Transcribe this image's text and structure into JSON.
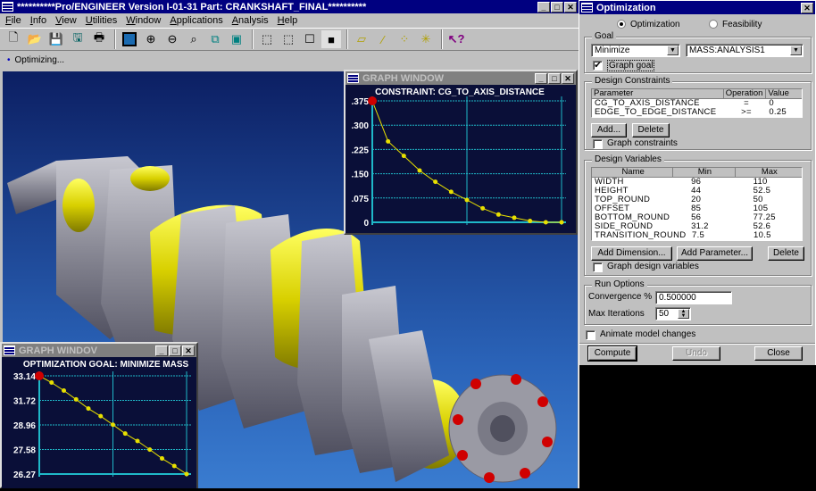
{
  "main_window": {
    "title": "**********Pro/ENGINEER Version I-01-31 Part: CRANKSHAFT_FINAL**********",
    "menu": [
      "File",
      "Info",
      "View",
      "Utilities",
      "Window",
      "Applications",
      "Analysis",
      "Help"
    ],
    "toolbar_icons": [
      "new-file-icon",
      "open-folder-icon",
      "save-icon",
      "save-copy-icon",
      "print-icon",
      "repaint-icon",
      "zoom-in-icon",
      "zoom-out-icon",
      "refit-icon",
      "orient-icon",
      "saved-views-icon",
      "wireframe-icon",
      "hidden-line-icon",
      "no-hidden-icon",
      "shading-icon",
      "datum-planes-icon",
      "datum-axes-icon",
      "datum-points-icon",
      "coordinate-systems-icon",
      "context-help-icon"
    ],
    "message": "Optimizing..."
  },
  "constraint_graph": {
    "window_title": "GRAPH WINDOW",
    "chart_data": {
      "type": "line",
      "title": "CONSTRAINT: CG_TO_AXIS_DISTANCE",
      "ylim": [
        0,
        0.375
      ],
      "ytick_labels": [
        ".375",
        ".300",
        ".225",
        ".150",
        ".075",
        "0"
      ],
      "yticks": [
        0.375,
        0.3,
        0.225,
        0.15,
        0.075,
        0
      ],
      "x": [
        0,
        1,
        2,
        3,
        4,
        5,
        6,
        7,
        8,
        9,
        10,
        11,
        12
      ],
      "values": [
        0.375,
        0.25,
        0.205,
        0.16,
        0.125,
        0.094,
        0.069,
        0.043,
        0.024,
        0.014,
        0.004,
        0,
        0
      ],
      "grid": true
    }
  },
  "goal_graph": {
    "window_title": "GRAPH WINDOV",
    "chart_data": {
      "type": "line",
      "title": "OPTIMIZATION GOAL: MINIMIZE MASS",
      "ylim": [
        26.27,
        33.14
      ],
      "ytick_labels": [
        "33.14",
        "31.72",
        "28.96",
        "27.58",
        "26.27"
      ],
      "x": [
        0,
        1,
        2,
        3,
        4,
        5,
        6,
        7,
        8,
        9,
        10,
        11,
        12
      ],
      "values": [
        33.14,
        32.67,
        32.11,
        31.49,
        30.85,
        30.32,
        29.72,
        29.1,
        28.58,
        27.98,
        27.36,
        26.83,
        26.27
      ],
      "grid": true
    }
  },
  "dialog": {
    "title": "Optimization",
    "mode_options": [
      {
        "label": "Optimization",
        "selected": true
      },
      {
        "label": "Feasibility",
        "selected": false
      }
    ],
    "goal": {
      "label": "Goal",
      "type": "Minimize",
      "target": "MASS:ANALYSIS1",
      "graph_goal_label": "Graph goal",
      "graph_goal_checked": true
    },
    "constraints": {
      "label": "Design Constraints",
      "headers": [
        "Parameter",
        "Operation",
        "Value"
      ],
      "rows": [
        [
          "CG_TO_AXIS_DISTANCE",
          "=",
          "0"
        ],
        [
          "EDGE_TO_EDGE_DISTANCE",
          ">=",
          "0.25"
        ]
      ],
      "add_label": "Add...",
      "delete_label": "Delete",
      "graph_label": "Graph constraints"
    },
    "variables": {
      "label": "Design Variables",
      "headers": [
        "Name",
        "Min",
        "Max"
      ],
      "rows": [
        [
          "WIDTH",
          "96",
          "110"
        ],
        [
          "HEIGHT",
          "44",
          "52.5"
        ],
        [
          "TOP_ROUND",
          "20",
          "50"
        ],
        [
          "OFFSET",
          "85",
          "105"
        ],
        [
          "BOTTOM_ROUND",
          "56",
          "77.25"
        ],
        [
          "SIDE_ROUND",
          "31.2",
          "52.6"
        ],
        [
          "TRANSITION_ROUND",
          "7.5",
          "10.5"
        ]
      ],
      "add_dimension_label": "Add Dimension...",
      "add_parameter_label": "Add Parameter...",
      "delete_label": "Delete",
      "graph_label": "Graph design variables"
    },
    "run_options": {
      "label": "Run Options",
      "convergence_label": "Convergence %",
      "convergence_value": "0.500000",
      "max_iterations_label": "Max Iterations",
      "max_iterations_value": "50"
    },
    "animate_label": "Animate model changes",
    "compute_label": "Compute",
    "undo_label": "Undo",
    "close_label": "Close"
  },
  "colors": {
    "title_active": "#000080",
    "plot_bg": "#0a0f38",
    "grid": "#1fb8c8",
    "series": "#e8e000",
    "start_point": "#d00000",
    "part_gray": "#9a9aa4",
    "part_yellow": "#e6e200"
  }
}
